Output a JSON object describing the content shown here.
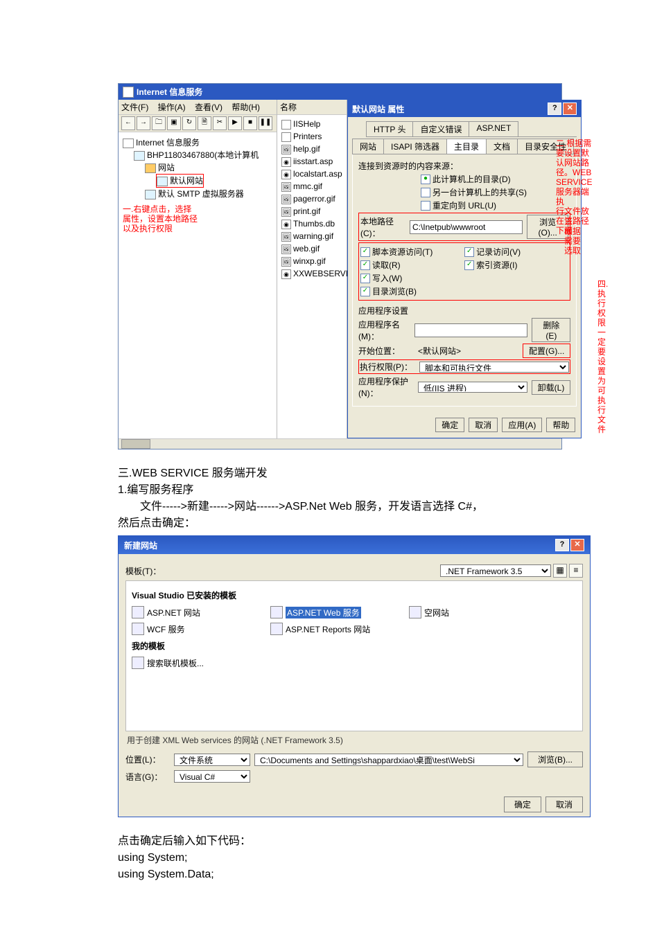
{
  "iis": {
    "title": "Internet 信息服务",
    "menus": [
      "文件(F)",
      "操作(A)",
      "查看(V)",
      "帮助(H)"
    ],
    "tree": {
      "root": "Internet 信息服务",
      "computer": "BHP11803467880(本地计算机",
      "websites_folder": "网站",
      "default_site": "默认网站",
      "smtp": "默认 SMTP 虚拟服务器"
    },
    "anno1_l1": "一.右键点击，选择",
    "anno1_l2": "属性，设置本地路径",
    "anno1_l3": "以及执行权限",
    "mid_header": "名称",
    "files": [
      "IISHelp",
      "Printers",
      "help.gif",
      "iisstart.asp",
      "localstart.asp",
      "mmc.gif",
      "pagerror.gif",
      "print.gif",
      "Thumbs.db",
      "warning.gif",
      "web.gif",
      "winxp.gif",
      "XXWEBSERVICE.dll"
    ]
  },
  "props": {
    "title": "默认网站 属性",
    "tabs_row1": [
      "HTTP 头",
      "自定义错误",
      "ASP.NET"
    ],
    "tabs_row2": [
      "网站",
      "ISAPI 筛选器",
      "主目录",
      "文档",
      "目录安全性"
    ],
    "active_tab": "主目录",
    "source_label": "连接到资源时的内容来源：",
    "opt_this": "此计算机上的目录(D)",
    "opt_share": "另一台计算机上的共享(S)",
    "opt_url": "重定向到 URL(U)",
    "local_path_label": "本地路径(C)：",
    "local_path_value": "C:\\Inetpub\\wwwroot",
    "browse_btn": "浏览(O)...",
    "chk_script": "脚本资源访问(T)",
    "chk_read": "读取(R)",
    "chk_write": "写入(W)",
    "chk_browse": "目录浏览(B)",
    "chk_log": "记录访问(V)",
    "chk_index": "索引资源(I)",
    "app_settings": "应用程序设置",
    "app_name_label": "应用程序名(M)：",
    "start_pos_label": "开始位置：",
    "start_pos_value": "<默认网站>",
    "exec_perm_label": "执行权限(P)：",
    "exec_perm_value": "脚本和可执行文件",
    "app_protect_label": "应用程序保护(N)：",
    "app_protect_value": "低(IIS 进程)",
    "btn_remove": "删除(E)",
    "btn_config": "配置(G)...",
    "btn_unload": "卸载(L)",
    "btn_ok": "确定",
    "btn_cancel": "取消",
    "btn_apply": "应用(A)",
    "btn_help": "帮助",
    "anno2_l1": "二.根据需要设置默认网站路",
    "anno2_l2": "径。WEB SERVICE服务器端执",
    "anno2_l3": "行文件放在该路径下面",
    "anno3": "三.根据需要选取",
    "anno4_l1": "四.执行权限一定",
    "anno4_l2": "要设置为可执行",
    "anno4_l3": "文件"
  },
  "doc": {
    "section_title": "三.WEB SERVICE 服务端开发",
    "step1": "1.编写服务程序",
    "step1_detail": "　　文件----->新建----->网站------>ASP.Net Web 服务，开发语言选择 C#，",
    "step1_detail2": "然后点击确定：",
    "after_ok": "点击确定后输入如下代码：",
    "code1": "using System;",
    "code2": "using System.Data;"
  },
  "new_dialog": {
    "title": "新建网站",
    "templates_label": "模板(T)：",
    "framework": ".NET Framework 3.5",
    "installed_group": "Visual Studio 已安装的模板",
    "tpl_aspnet_site": "ASP.NET 网站",
    "tpl_wcf": "WCF 服务",
    "tpl_webservice": "ASP.NET Web 服务",
    "tpl_reports": "ASP.NET Reports 网站",
    "tpl_empty": "空网站",
    "my_templates": "我的模板",
    "tpl_search": "搜索联机模板...",
    "description": "用于创建 XML Web services 的网站 (.NET Framework 3.5)",
    "location_label": "位置(L)：",
    "location_type": "文件系统",
    "location_path": "C:\\Documents and Settings\\shappardxiao\\桌面\\test\\WebSi",
    "browse_btn": "浏览(B)...",
    "language_label": "语言(G)：",
    "language_value": "Visual C#",
    "btn_ok": "确定",
    "btn_cancel": "取消"
  }
}
